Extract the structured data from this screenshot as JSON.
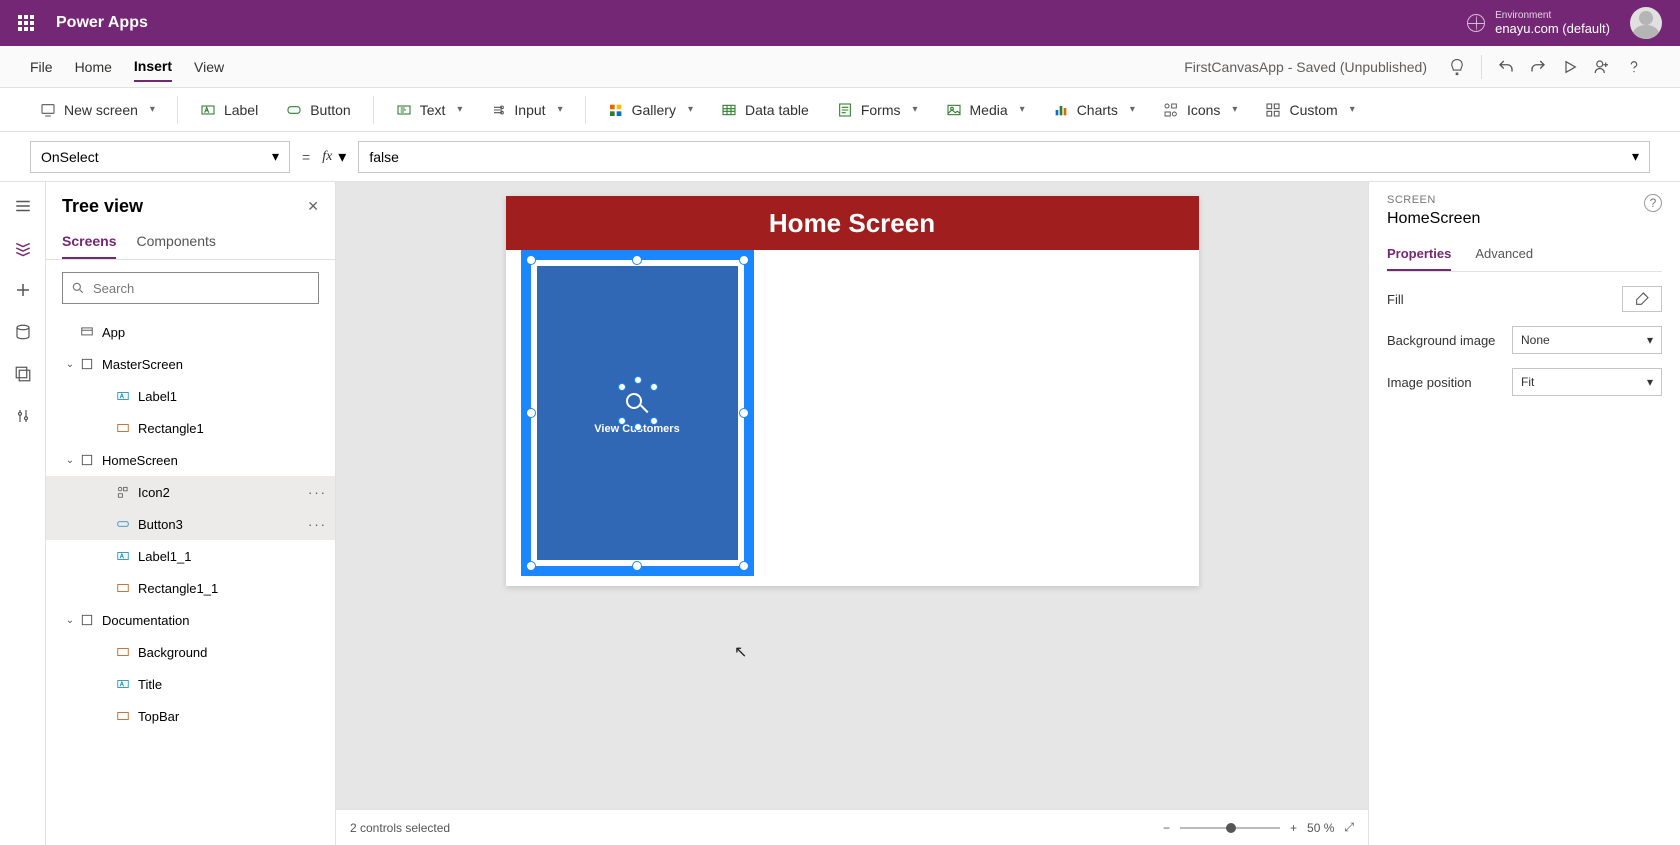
{
  "brand": "Power Apps",
  "environment": {
    "label": "Environment",
    "value": "enayu.com (default)"
  },
  "menu": {
    "file": "File",
    "home": "Home",
    "insert": "Insert",
    "view": "View"
  },
  "appStatus": "FirstCanvasApp - Saved (Unpublished)",
  "ribbon": {
    "new_screen": "New screen",
    "label": "Label",
    "button": "Button",
    "text": "Text",
    "input": "Input",
    "gallery": "Gallery",
    "data_table": "Data table",
    "forms": "Forms",
    "media": "Media",
    "charts": "Charts",
    "icons": "Icons",
    "custom": "Custom"
  },
  "formula": {
    "property": "OnSelect",
    "fx": "fx",
    "value": "false"
  },
  "tree": {
    "title": "Tree view",
    "tabs": {
      "screens": "Screens",
      "components": "Components"
    },
    "search_placeholder": "Search",
    "app": "App",
    "master": "MasterScreen",
    "master_label1": "Label1",
    "master_rect1": "Rectangle1",
    "home": "HomeScreen",
    "home_icon2": "Icon2",
    "home_button3": "Button3",
    "home_label11": "Label1_1",
    "home_rect11": "Rectangle1_1",
    "doc": "Documentation",
    "doc_bg": "Background",
    "doc_title": "Title",
    "doc_topbar": "TopBar"
  },
  "canvas": {
    "header": "Home Screen",
    "button_label": "View Customers"
  },
  "status": {
    "selection": "2 controls selected",
    "zoom_value": "50",
    "zoom_suffix": "%"
  },
  "props": {
    "kicker": "SCREEN",
    "title": "HomeScreen",
    "tabs": {
      "properties": "Properties",
      "advanced": "Advanced"
    },
    "fill_label": "Fill",
    "bgimage_label": "Background image",
    "bgimage_value": "None",
    "imgpos_label": "Image position",
    "imgpos_value": "Fit"
  }
}
